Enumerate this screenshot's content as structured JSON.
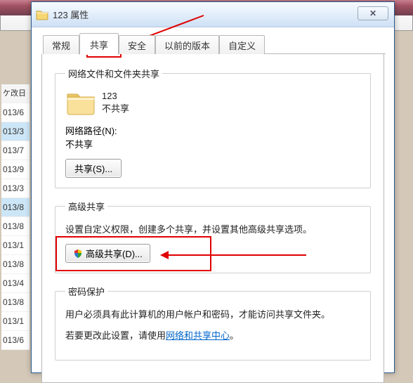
{
  "bg": {
    "header": "ケ改日",
    "rows": [
      "013/6",
      "013/3",
      "013/7",
      "013/9",
      "013/3",
      "013/8",
      "013/8",
      "013/1",
      "013/8",
      "013/4",
      "013/8",
      "013/1",
      "013/6"
    ]
  },
  "dialog": {
    "title": "123 属性",
    "close_glyph": "✕"
  },
  "tabs": {
    "general": "常规",
    "share": "共享",
    "security": "安全",
    "versions": "以前的版本",
    "custom": "自定义"
  },
  "share_panel": {
    "group1": {
      "legend": "网络文件和文件夹共享",
      "folder_name": "123",
      "folder_status": "不共享",
      "path_label": "网络路径(N):",
      "path_value": "不共享",
      "share_btn": "共享(S)..."
    },
    "group2": {
      "legend": "高级共享",
      "desc": "设置自定义权限，创建多个共享，并设置其他高级共享选项。",
      "adv_btn": "高级共享(D)..."
    },
    "group3": {
      "legend": "密码保护",
      "line1": "用户必须具有此计算机的用户帐户和密码，才能访问共享文件夹。",
      "line2_a": "若要更改此设置，请使用",
      "line2_link": "网络和共享中心",
      "line2_b": "。"
    }
  }
}
